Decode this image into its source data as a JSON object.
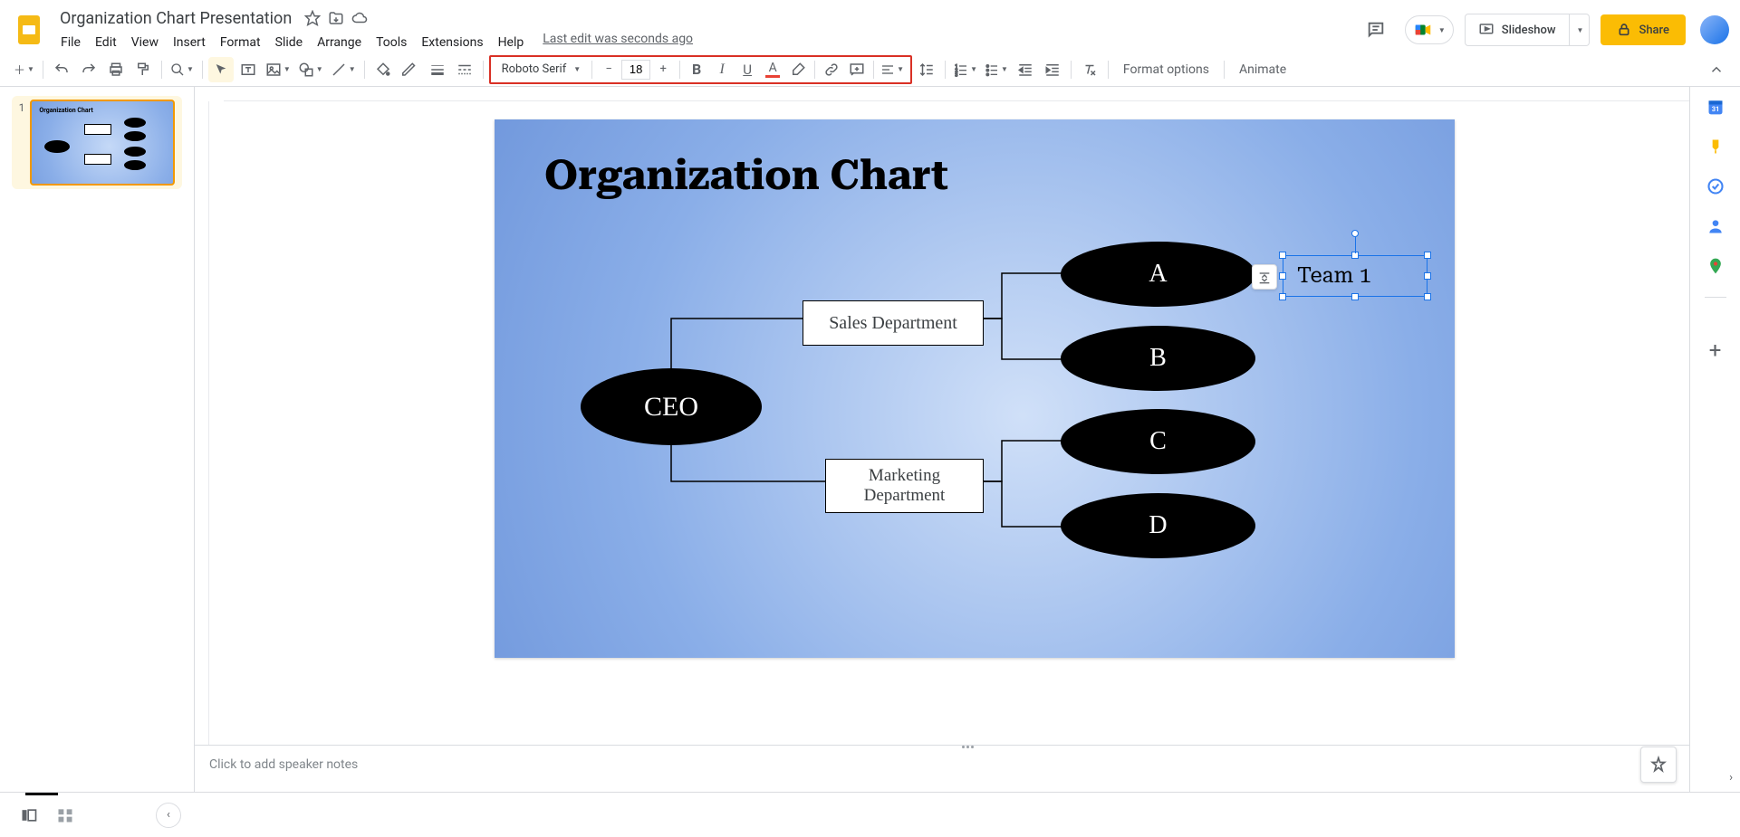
{
  "doc": {
    "title": "Organization Chart Presentation",
    "last_edit": "Last edit was seconds ago"
  },
  "menu": {
    "file": "File",
    "edit": "Edit",
    "view": "View",
    "insert": "Insert",
    "format": "Format",
    "slide": "Slide",
    "arrange": "Arrange",
    "tools": "Tools",
    "extensions": "Extensions",
    "help": "Help"
  },
  "header_buttons": {
    "slideshow": "Slideshow",
    "share": "Share"
  },
  "toolbar": {
    "font": "Roboto Serif",
    "font_size": "18",
    "format_options": "Format options",
    "animate": "Animate"
  },
  "filmstrip": {
    "slide1_num": "1",
    "thumb_title": "Organization Chart"
  },
  "slide": {
    "title": "Organization Chart",
    "ceo": "CEO",
    "dept1": "Sales Department",
    "dept2": "Marketing Department",
    "nodeA": "A",
    "nodeB": "B",
    "nodeC": "C",
    "nodeD": "D",
    "team1": "Team 1"
  },
  "notes": {
    "placeholder": "Click to add speaker notes"
  },
  "sidepanel": {
    "calendar_day": "31"
  }
}
